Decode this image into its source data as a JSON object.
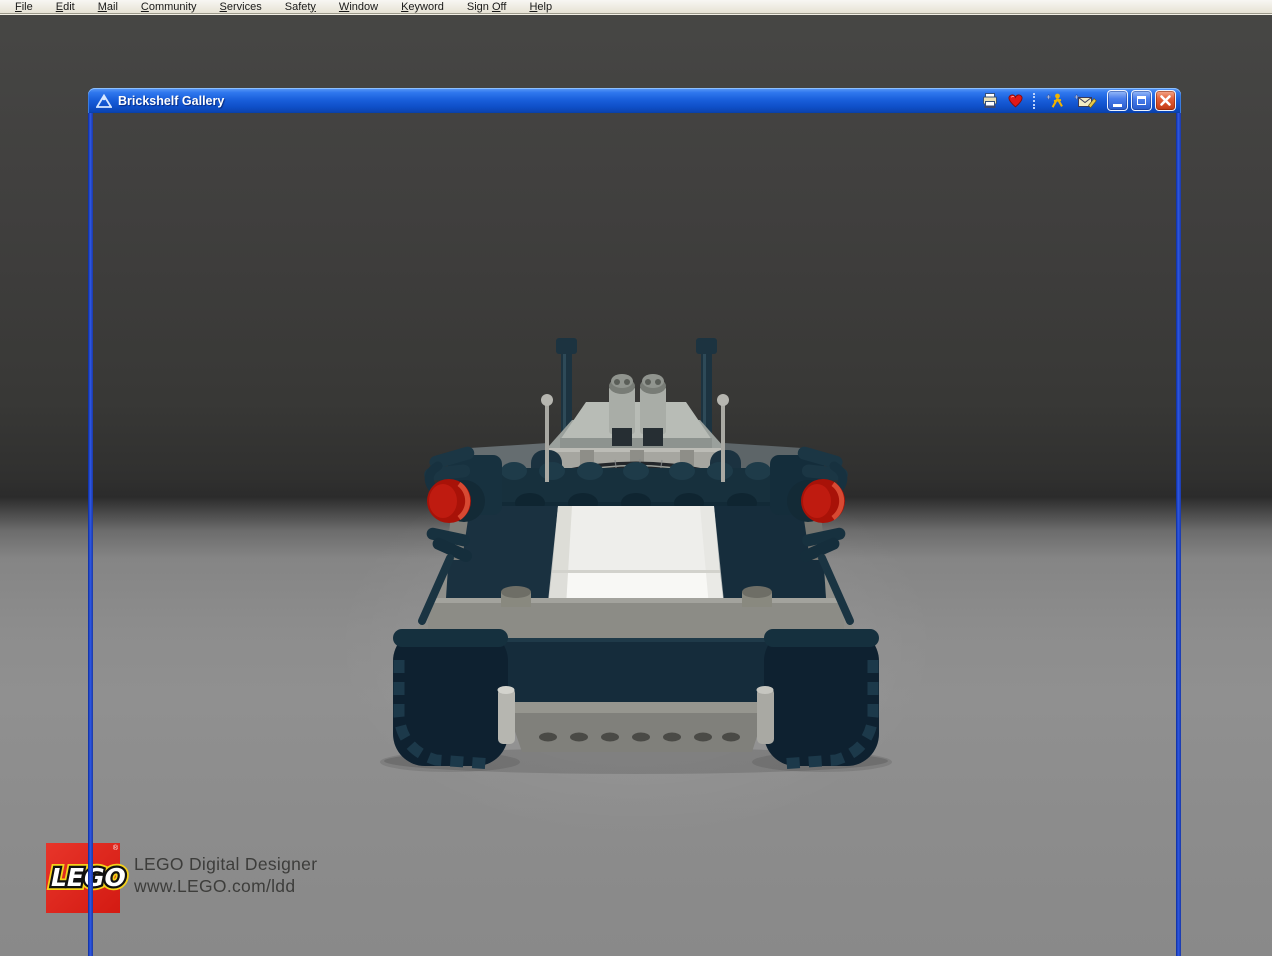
{
  "menu_bar": {
    "items": [
      {
        "label": "File",
        "underline": 0
      },
      {
        "label": "Edit",
        "underline": 0
      },
      {
        "label": "Mail",
        "underline": 0
      },
      {
        "label": "Community",
        "underline": 0
      },
      {
        "label": "Services",
        "underline": 0
      },
      {
        "label": "Safety",
        "underline": 5
      },
      {
        "label": "Window",
        "underline": 0
      },
      {
        "label": "Keyword",
        "underline": 0
      },
      {
        "label": "Sign Off",
        "underline": 5
      },
      {
        "label": "Help",
        "underline": 0
      }
    ]
  },
  "window": {
    "title": "Brickshelf Gallery",
    "titlebar_icons": [
      "print",
      "favorite-heart",
      "aol-buddy-add",
      "write-mail"
    ],
    "window_buttons": [
      "minimize",
      "maximize",
      "close"
    ]
  },
  "content": {
    "logo_text": "LEGO",
    "logo_reg": "®",
    "watermark_line1": "LEGO Digital Designer",
    "watermark_line2": "www.LEGO.com/ldd",
    "scene_subject": "LEGO Digital Designer render of a dark navy tracked vehicle, front view, on gray studio backdrop"
  },
  "colors": {
    "titlebar_blue": "#1a60dc",
    "frame_blue": "#2e57e2",
    "close_button_red": "#cc431c",
    "menu_bar_gray": "#ece8db",
    "backdrop_dark": "#434341",
    "backdrop_light": "#8c8c8c",
    "lego_red": "#d9261c",
    "lego_yellow": "#f5d21a",
    "vehicle_navy": "#16303d",
    "vehicle_tread": "#0e2130",
    "vehicle_light_gray": "#b0b0aa",
    "windshield_white": "#f2f2ef",
    "red_light": "#b5150c"
  }
}
